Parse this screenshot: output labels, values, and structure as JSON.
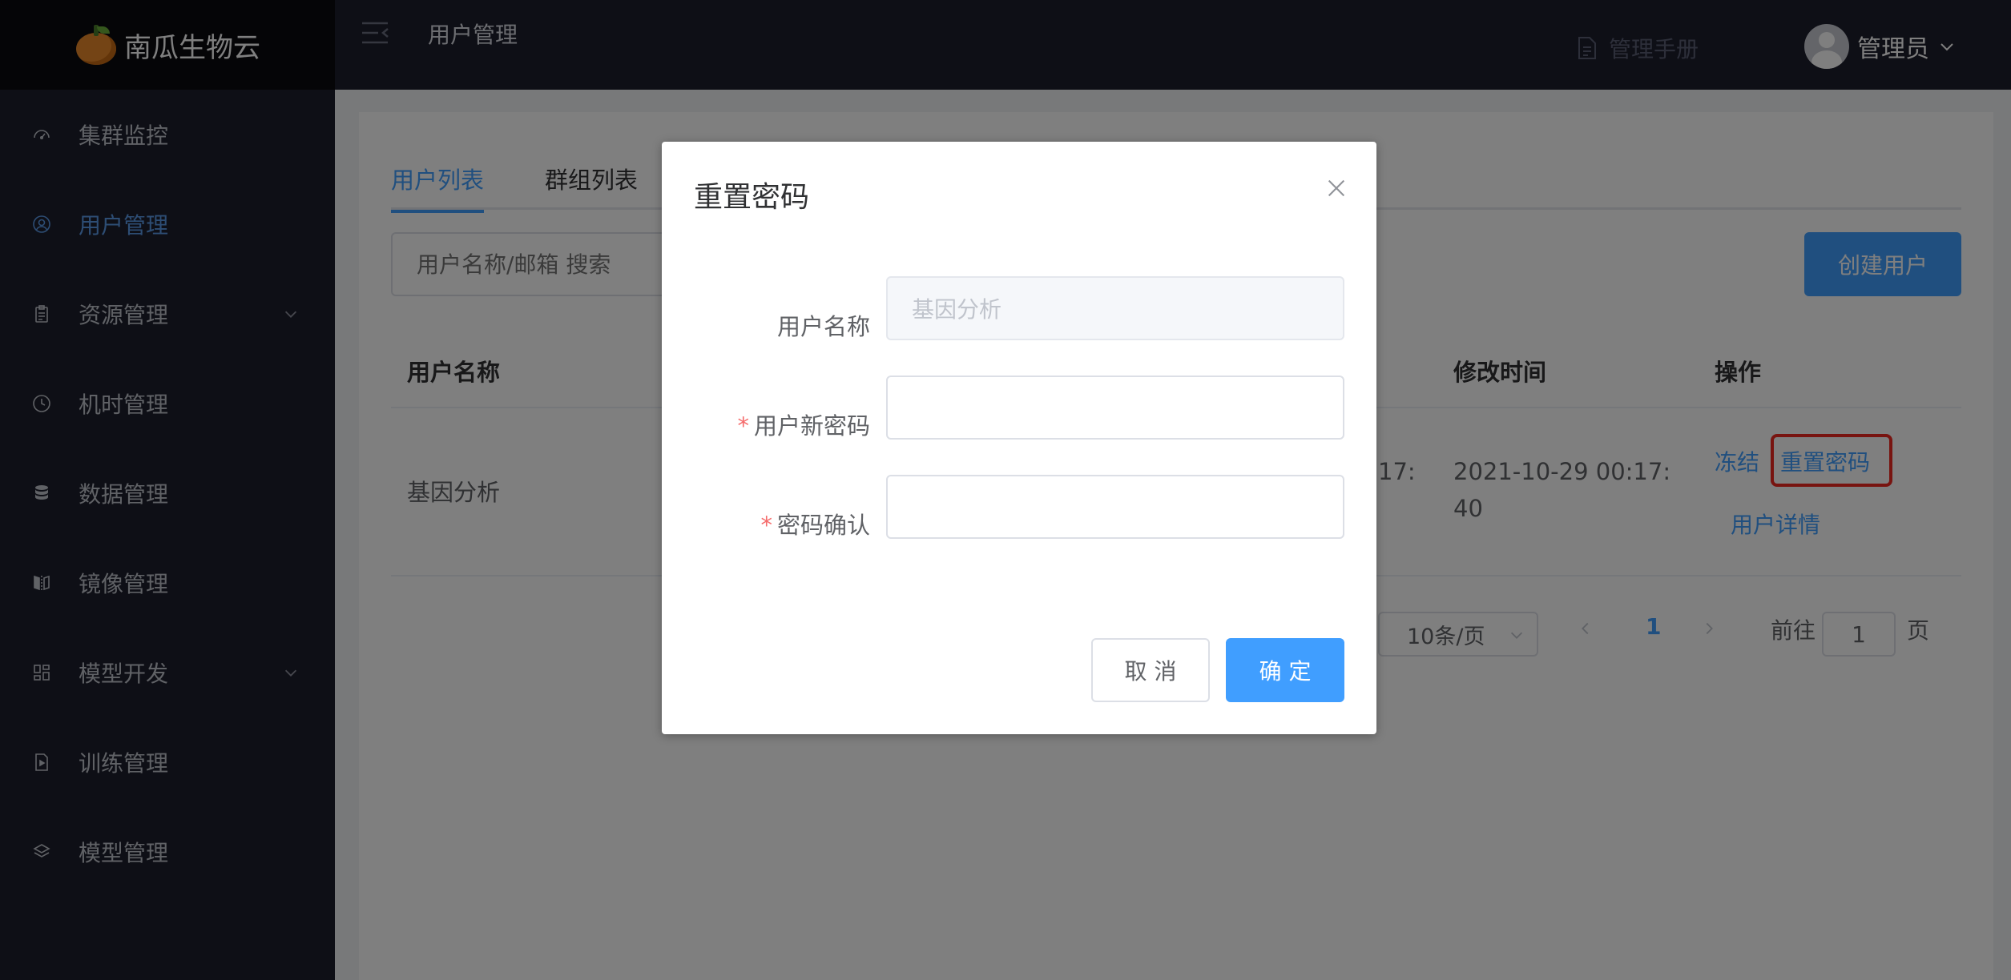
{
  "app": {
    "name": "南瓜生物云"
  },
  "sidebar": {
    "items": [
      {
        "label": "集群监控",
        "icon": "dashboard-icon"
      },
      {
        "label": "用户管理",
        "icon": "user-icon",
        "active": true
      },
      {
        "label": "资源管理",
        "icon": "clipboard-icon",
        "expandable": true
      },
      {
        "label": "机时管理",
        "icon": "clock-icon"
      },
      {
        "label": "数据管理",
        "icon": "database-icon"
      },
      {
        "label": "镜像管理",
        "icon": "mirror-icon"
      },
      {
        "label": "模型开发",
        "icon": "grid-icon",
        "expandable": true
      },
      {
        "label": "训练管理",
        "icon": "file-play-icon"
      },
      {
        "label": "模型管理",
        "icon": "layers-icon"
      }
    ]
  },
  "header": {
    "title": "用户管理",
    "manual": "管理手册",
    "user": "管理员"
  },
  "main": {
    "tabs": [
      "用户列表",
      "群组列表"
    ],
    "search_placeholder": "用户名称/邮箱 搜索",
    "create_button": "创建用户",
    "columns": {
      "name": "用户名称",
      "modified": "修改时间",
      "actions": "操作"
    },
    "row": {
      "name": "基因分析",
      "partial_time": "17:",
      "modified_line1": "2021-10-29 00:17:",
      "modified_line2": "40",
      "action_freeze": "冻结",
      "action_reset": "重置密码",
      "action_detail": "用户详情"
    },
    "pagination": {
      "page_size": "10条/页",
      "current_page": "1",
      "goto_label": "前往",
      "goto_value": "1",
      "page_suffix": "页"
    }
  },
  "dialog": {
    "title": "重置密码",
    "username_label": "用户名称",
    "username_value": "基因分析",
    "new_password_label": "用户新密码",
    "confirm_label": "密码确认",
    "required_mark": "*",
    "cancel": "取 消",
    "confirm": "确 定"
  },
  "colors": {
    "sidebar_bg": "#1d1e2c",
    "accent": "#409eff",
    "highlight_box": "#f02820"
  }
}
